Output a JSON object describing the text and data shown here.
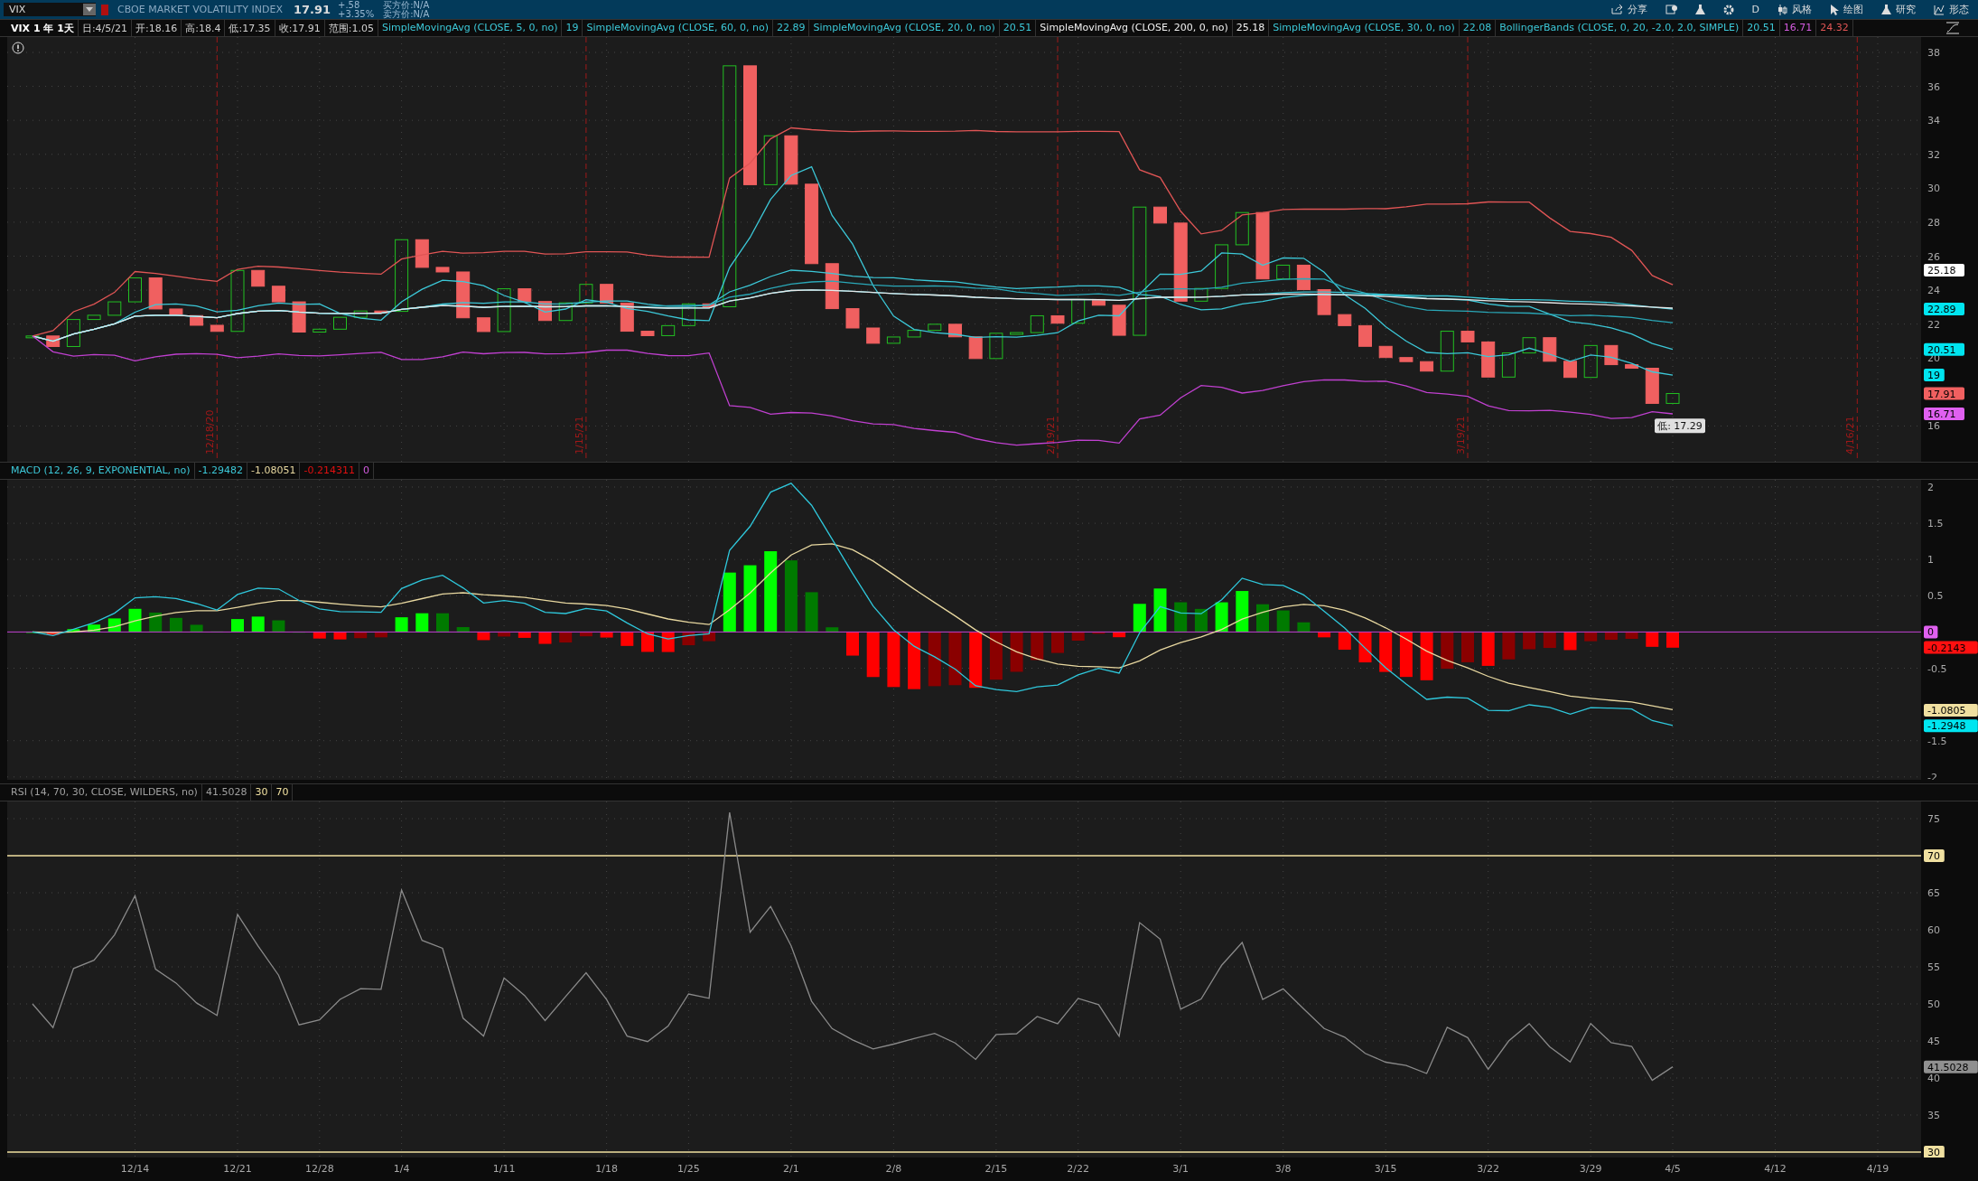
{
  "toolbar": {
    "symbol": "VIX",
    "description": "CBOE MARKET VOLATILITY INDEX",
    "last": "17.91",
    "change": "+.58",
    "change_pct": "+3.35%",
    "bid": "买方价:N/A",
    "ask": "卖方价:N/A",
    "buttons": [
      {
        "kind": "share",
        "label": "分享"
      },
      {
        "kind": "alert"
      },
      {
        "kind": "flask"
      },
      {
        "kind": "gear"
      },
      {
        "kind": "text",
        "label": "D"
      },
      {
        "kind": "style",
        "label": "风格"
      },
      {
        "kind": "draw",
        "label": "绘图"
      },
      {
        "kind": "study",
        "label": "研究"
      },
      {
        "kind": "pattern",
        "label": "形态"
      }
    ]
  },
  "price_header": [
    {
      "text": "VIX 1 年 1天",
      "color": "#ffffff"
    },
    {
      "text": "日:4/5/21",
      "color": "#d0d0d0"
    },
    {
      "text": "开:18.16",
      "color": "#d0d0d0"
    },
    {
      "text": "高:18.4",
      "color": "#d0d0d0"
    },
    {
      "text": "低:17.35",
      "color": "#d0d0d0"
    },
    {
      "text": "收:17.91",
      "color": "#d0d0d0"
    },
    {
      "text": "范围:1.05",
      "color": "#d0d0d0"
    },
    {
      "text": "SimpleMovingAvg (CLOSE, 5, 0, no)",
      "color": "#3cc8d8"
    },
    {
      "text": "19",
      "color": "#3cc8d8"
    },
    {
      "text": "SimpleMovingAvg (CLOSE, 60, 0, no)",
      "color": "#3cc8d8"
    },
    {
      "text": "22.89",
      "color": "#3cc8d8"
    },
    {
      "text": "SimpleMovingAvg (CLOSE, 20, 0, no)",
      "color": "#3cc8d8"
    },
    {
      "text": "20.51",
      "color": "#3cc8d8"
    },
    {
      "text": "SimpleMovingAvg (CLOSE, 200, 0, no)",
      "color": "#f0f0f0"
    },
    {
      "text": "25.18",
      "color": "#f0f0f0"
    },
    {
      "text": "SimpleMovingAvg (CLOSE, 30, 0, no)",
      "color": "#3cc8d8"
    },
    {
      "text": "22.08",
      "color": "#3cc8d8"
    },
    {
      "text": "BollingerBands (CLOSE, 0, 20, -2.0, 2.0, SIMPLE)",
      "color": "#3cc8d8"
    },
    {
      "text": "20.51",
      "color": "#3cc8d8"
    },
    {
      "text": "16.71",
      "color": "#d45ce0"
    },
    {
      "text": "24.32",
      "color": "#e05555"
    }
  ],
  "price_chart": {
    "axis_labels": [
      "38",
      "36",
      "34",
      "32",
      "30",
      "28",
      "26",
      "24",
      "22",
      "20",
      "16"
    ],
    "expiry_labels": [
      "12/18/20",
      "1/15/21",
      "2/19/21",
      "3/19/21",
      "4/16/21"
    ],
    "callout": "低: 17.29",
    "value_tags": [
      {
        "text": "25.18",
        "color": "#ffffff"
      },
      {
        "text": "22.89",
        "color": "#00e5f0"
      },
      {
        "text": "20.51",
        "color": "#00e5f0"
      },
      {
        "text": "19",
        "color": "#00e5f0"
      },
      {
        "text": "17.91",
        "color": "#f06060"
      },
      {
        "text": "16.71",
        "color": "#e060f0"
      }
    ]
  },
  "macd_header": [
    {
      "text": "MACD (12, 26, 9, EXPONENTIAL, no)",
      "color": "#3cc8d8"
    },
    {
      "text": "-1.29482",
      "color": "#3cc8d8"
    },
    {
      "text": "-1.08051",
      "color": "#e8d8a0"
    },
    {
      "text": "-0.214311",
      "color": "#e01010"
    },
    {
      "text": "0",
      "color": "#d45ce0"
    }
  ],
  "macd_panel": {
    "axis_labels": [
      "2",
      "1.5",
      "1",
      "0.5",
      "-0.5",
      "-1.5",
      "-2"
    ],
    "value_tags": [
      {
        "text": "0",
        "color": "#e060f0"
      },
      {
        "text": "-0.2143",
        "color": "#ff1010"
      },
      {
        "text": "-1.0805",
        "color": "#f0e0a0"
      },
      {
        "text": "-1.2948",
        "color": "#00e5f0"
      }
    ]
  },
  "rsi_header": [
    {
      "text": "RSI (14, 70, 30, CLOSE, WILDERS, no)",
      "color": "#a0a0a0"
    },
    {
      "text": "41.5028",
      "color": "#a0a0a0"
    },
    {
      "text": "30",
      "color": "#f0e0a0"
    },
    {
      "text": "70",
      "color": "#f0e0a0"
    }
  ],
  "rsi_panel": {
    "axis_labels": [
      "75",
      "65",
      "60",
      "55",
      "50",
      "45",
      "40",
      "35"
    ],
    "value_tags": [
      {
        "kind": "level",
        "text": "70",
        "color": "#f0e0a0"
      },
      {
        "kind": "value",
        "text": "41.5028",
        "color": "#909090"
      },
      {
        "kind": "level",
        "text": "30",
        "color": "#f0e0a0"
      }
    ]
  },
  "date_axis": [
    "12/14",
    "12/21",
    "12/28",
    "1/4",
    "1/11",
    "1/18",
    "1/25",
    "2/1",
    "2/8",
    "2/15",
    "2/22",
    "3/1",
    "3/8",
    "3/15",
    "3/22",
    "3/29",
    "4/5",
    "4/12",
    "4/19"
  ]
}
